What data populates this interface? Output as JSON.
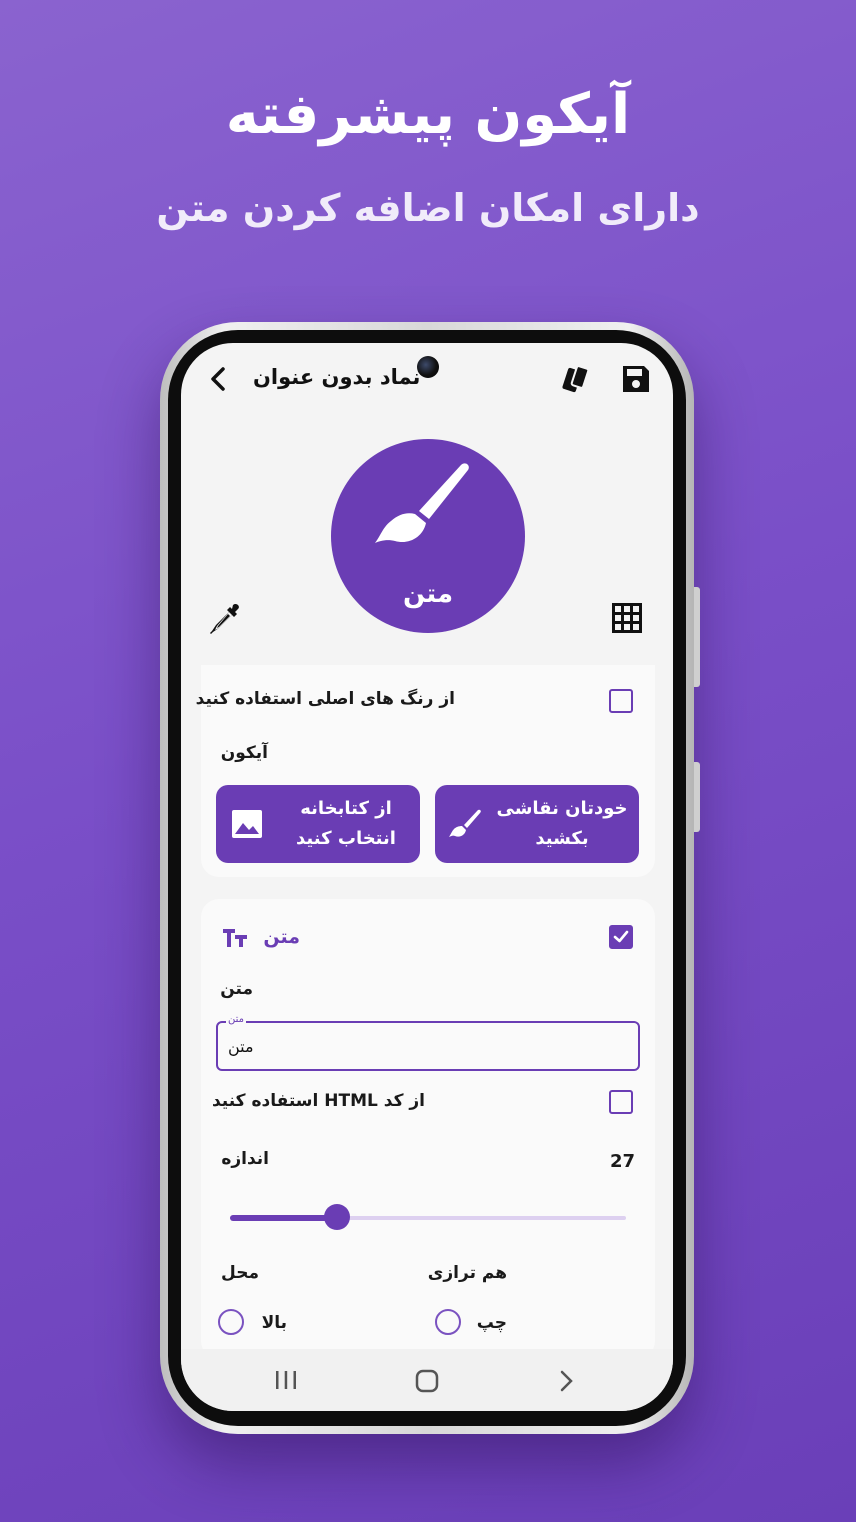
{
  "promo": {
    "title": "آیکون پیشرفته",
    "subtitle": "دارای امکان اضافه کردن متن"
  },
  "colors": {
    "accent": "#6a3db4",
    "background": "#7a4fc8"
  },
  "app": {
    "title": "نماد بدون عنوان",
    "icons": [
      "back-arrow-icon",
      "cards-icon",
      "save-icon",
      "color-picker-icon",
      "grid-icon",
      "brush-icon"
    ]
  },
  "preview": {
    "icon_text": "متن"
  },
  "icon_section": {
    "use_original_colors_label": "از رنگ های اصلی استفاده کنید",
    "use_original_colors_checked": false,
    "heading": "آیکون",
    "draw_button": "خودتان نقاشی\nبکشید",
    "library_button": "از کتابخانه\nانتخاب کنید"
  },
  "text_section": {
    "heading": "متن",
    "enabled": true,
    "field_label": "متن",
    "input_hint": "متن",
    "input_value": "متن",
    "html_label": "از کد HTML استفاده کنید",
    "html_checked": false,
    "size_label": "اندازه",
    "size_value": "27",
    "size_fraction": 0.27,
    "position_label": "محل",
    "position_option": "بالا",
    "alignment_label": "هم ترازی",
    "alignment_option": "چپ"
  },
  "navbar": {
    "items": [
      "recents-icon",
      "home-icon",
      "back-icon"
    ]
  }
}
